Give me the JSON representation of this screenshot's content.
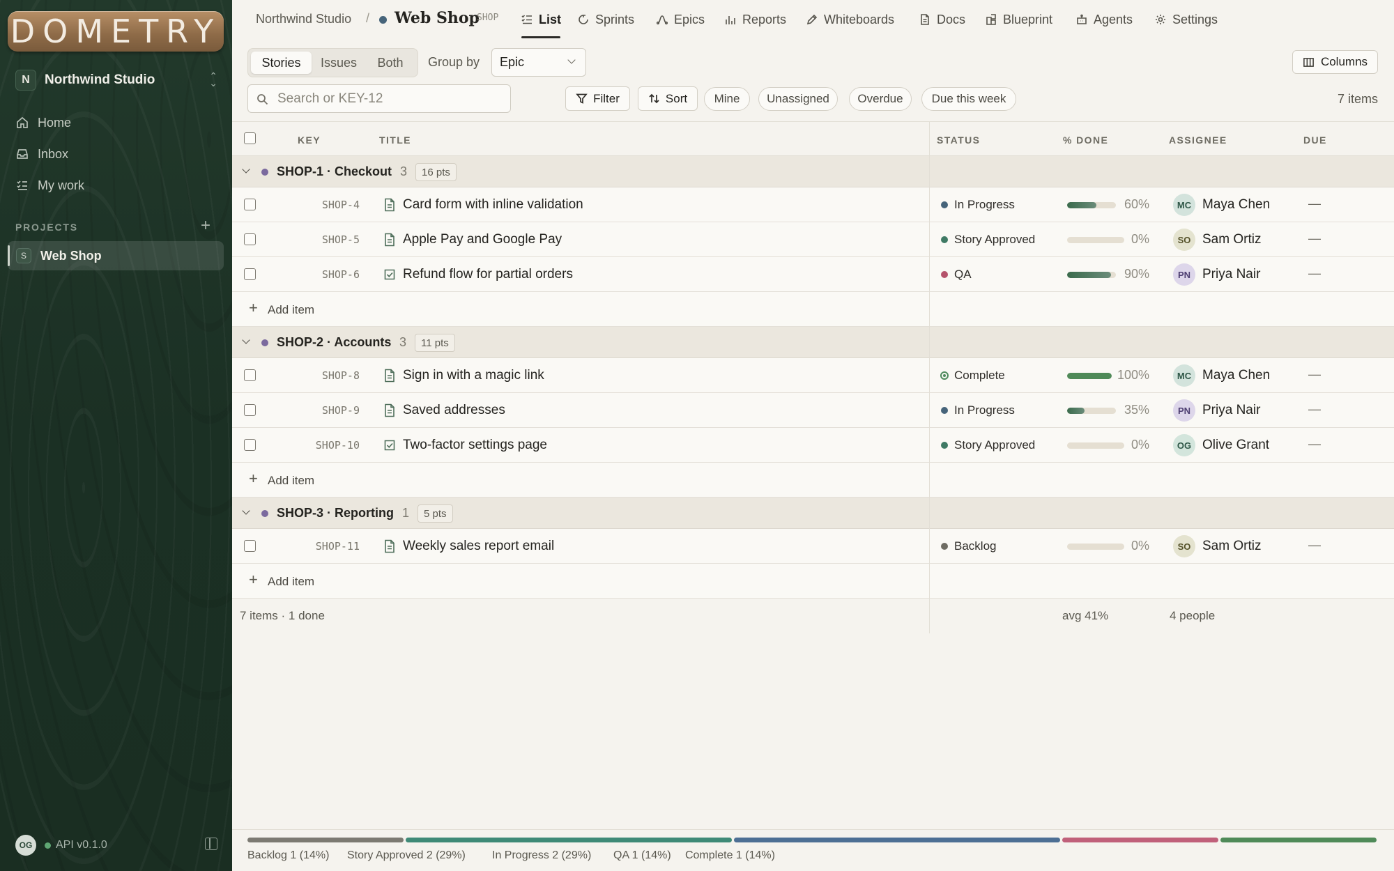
{
  "sidebar": {
    "logo": "DOMETRY",
    "workspace": {
      "initial": "N",
      "name": "Northwind Studio"
    },
    "nav": [
      {
        "label": "Home",
        "icon": "home-icon"
      },
      {
        "label": "Inbox",
        "icon": "inbox-icon"
      },
      {
        "label": "My work",
        "icon": "checklist-icon"
      }
    ],
    "projects_label": "PROJECTS",
    "projects": [
      {
        "initial": "S",
        "name": "Web Shop"
      }
    ],
    "footer": {
      "user_initials": "OG",
      "api_version": "API v0.1.0"
    }
  },
  "header": {
    "breadcrumb_workspace": "Northwind Studio",
    "breadcrumb_separator": "/",
    "project_name": "Web Shop",
    "project_key": "SHOP",
    "tabs": [
      {
        "label": "List",
        "icon": "list-icon",
        "active": true
      },
      {
        "label": "Sprints",
        "icon": "sprint-icon"
      },
      {
        "label": "Epics",
        "icon": "epic-icon"
      },
      {
        "label": "Reports",
        "icon": "reports-icon"
      },
      {
        "label": "Whiteboards",
        "icon": "pencil-icon"
      },
      {
        "label": "Docs",
        "icon": "doc-icon"
      },
      {
        "label": "Blueprint",
        "icon": "blueprint-icon"
      },
      {
        "label": "Agents",
        "icon": "robot-icon"
      },
      {
        "label": "Settings",
        "icon": "gear-icon"
      }
    ]
  },
  "toolbar": {
    "type_filter": [
      "Stories",
      "Issues",
      "Both"
    ],
    "type_active": "Stories",
    "group_by_label": "Group by",
    "group_by_value": "Epic",
    "columns_label": "Columns",
    "search_placeholder": "Search or KEY-12",
    "filter_label": "Filter",
    "sort_label": "Sort",
    "quick_filters": [
      "Mine",
      "Unassigned",
      "Overdue",
      "Due this week"
    ],
    "items_count": "7 items"
  },
  "table": {
    "columns": [
      "KEY",
      "TITLE",
      "STATUS",
      "% DONE",
      "ASSIGNEE",
      "DUE"
    ],
    "groups": [
      {
        "name": "SHOP-1 · Checkout",
        "count": "3",
        "points": "16 pts",
        "rows": [
          {
            "key": "SHOP-4",
            "type": "story",
            "title": "Card form with inline validation",
            "status": "In Progress",
            "status_color": "#46647a",
            "percent": 60,
            "percent_label": "60%",
            "assignee_initials": "MC",
            "assignee": "Maya Chen",
            "due": "—"
          },
          {
            "key": "SHOP-5",
            "type": "story",
            "title": "Apple Pay and Google Pay",
            "status": "Story Approved",
            "status_color": "#3f7a64",
            "percent": 0,
            "percent_label": "0%",
            "assignee_initials": "SO",
            "assignee": "Sam Ortiz",
            "due": "—"
          },
          {
            "key": "SHOP-6",
            "type": "task",
            "title": "Refund flow for partial orders",
            "status": "QA",
            "status_color": "#b5536b",
            "percent": 90,
            "percent_label": "90%",
            "assignee_initials": "PN",
            "assignee": "Priya Nair",
            "due": "—"
          }
        ]
      },
      {
        "name": "SHOP-2 · Accounts",
        "count": "3",
        "points": "11 pts",
        "rows": [
          {
            "key": "SHOP-8",
            "type": "story",
            "title": "Sign in with a magic link",
            "status": "Complete",
            "status_color": "#4e8a5d",
            "percent": 100,
            "percent_label": "100%",
            "assignee_initials": "MC",
            "assignee": "Maya Chen",
            "due": "—"
          },
          {
            "key": "SHOP-9",
            "type": "story",
            "title": "Saved addresses",
            "status": "In Progress",
            "status_color": "#46647a",
            "percent": 35,
            "percent_label": "35%",
            "assignee_initials": "PN",
            "assignee": "Priya Nair",
            "due": "—"
          },
          {
            "key": "SHOP-10",
            "type": "task",
            "title": "Two-factor settings page",
            "status": "Story Approved",
            "status_color": "#3f7a64",
            "percent": 0,
            "percent_label": "0%",
            "assignee_initials": "OG",
            "assignee": "Olive Grant",
            "due": "—"
          }
        ]
      },
      {
        "name": "SHOP-3 · Reporting",
        "count": "1",
        "points": "5 pts",
        "rows": [
          {
            "key": "SHOP-11",
            "type": "story",
            "title": "Weekly sales report email",
            "status": "Backlog",
            "status_color": "#6e6c63",
            "percent": 0,
            "percent_label": "0%",
            "assignee_initials": "SO",
            "assignee": "Sam Ortiz",
            "due": "—"
          }
        ]
      }
    ],
    "add_item_label": "Add item",
    "summary": {
      "items": "7 items · 1 done",
      "avg": "avg 41%",
      "people": "4 people"
    }
  },
  "status_distribution": [
    {
      "label": "Backlog 1 (14%)",
      "share": 14,
      "color": "#7c7a72"
    },
    {
      "label": "Story Approved 2 (29%)",
      "share": 29,
      "color": "#3f8a77"
    },
    {
      "label": "In Progress 2 (29%)",
      "share": 29,
      "color": "#4d6f94"
    },
    {
      "label": "QA 1 (14%)",
      "share": 14,
      "color": "#c0607a"
    },
    {
      "label": "Complete 1 (14%)",
      "share": 14,
      "color": "#4f8a58"
    }
  ],
  "colors": {
    "avatar_MC": "#d3e3dc",
    "avatar_SO": "#e4e3cf",
    "avatar_PN": "#ddd6ea",
    "avatar_OG": "#d3e5dc"
  }
}
